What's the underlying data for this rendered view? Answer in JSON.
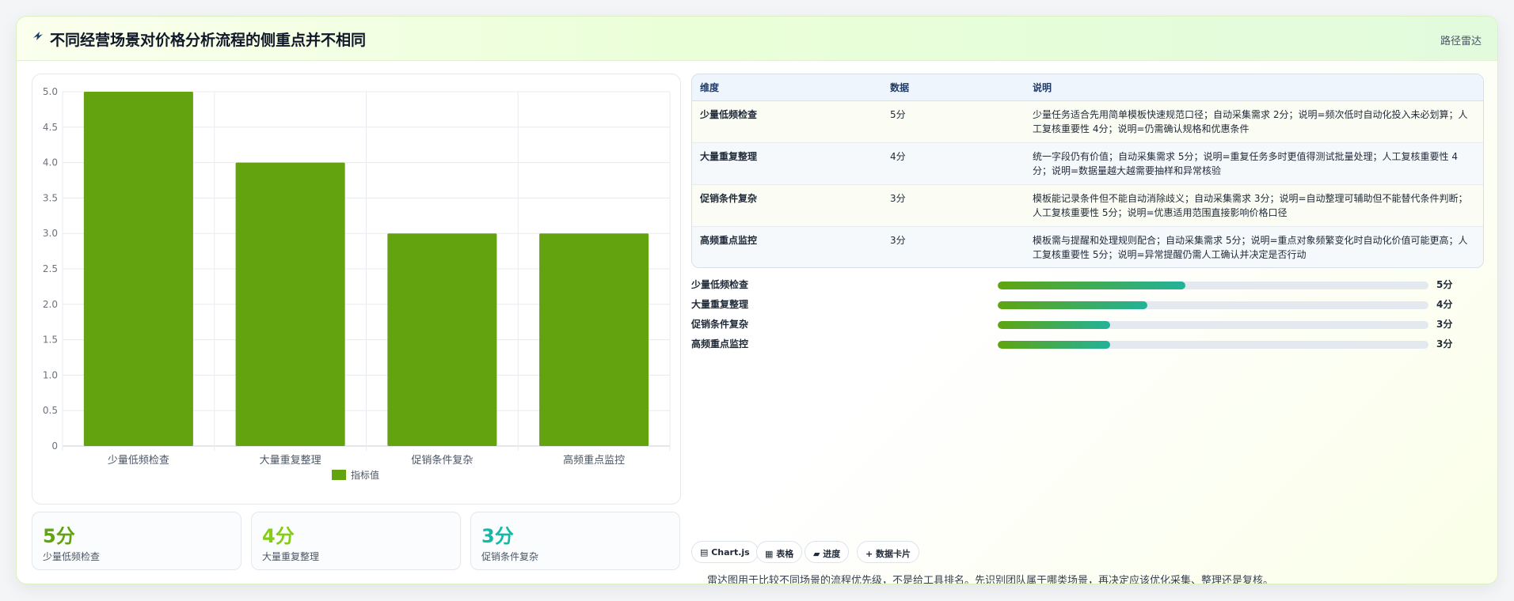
{
  "header": {
    "icon": "sparkle-icon",
    "title": "不同经营场景对价格分析流程的侧重点并不相同",
    "link": "路径雷达"
  },
  "colors": {
    "accent": "#62a30f",
    "teal": "#22b29a",
    "stat1": "#62a30f",
    "stat2": "#84cc16",
    "stat3": "#14b8a6"
  },
  "chart_data": {
    "type": "bar",
    "categories": [
      "少量低频检查",
      "大量重复整理",
      "促销条件复杂",
      "高频重点监控"
    ],
    "series": [
      {
        "name": "指标值",
        "values": [
          5,
          4,
          3,
          3
        ],
        "color": "#62a30f"
      }
    ],
    "yticks": [
      "0",
      "0.5",
      "1.0",
      "1.5",
      "2.0",
      "2.5",
      "3.0",
      "3.5",
      "4.0",
      "4.5",
      "5.0"
    ],
    "ylim": [
      0,
      5
    ],
    "grid": true,
    "legend": "bottom"
  },
  "stats": [
    {
      "value": "5分",
      "label": "少量低频检查"
    },
    {
      "value": "4分",
      "label": "大量重复整理"
    },
    {
      "value": "3分",
      "label": "促销条件复杂"
    }
  ],
  "table": {
    "headers": [
      "维度",
      "数据",
      "说明"
    ],
    "rows": [
      {
        "dim": "少量低频检查",
        "data": "5分",
        "desc": "少量任务适合先用简单模板快速规范口径；自动采集需求 2分；说明=频次低时自动化投入未必划算；人工复核重要性 4分；说明=仍需确认规格和优惠条件"
      },
      {
        "dim": "大量重复整理",
        "data": "4分",
        "desc": "统一字段仍有价值；自动采集需求 5分；说明=重复任务多时更值得测试批量处理；人工复核重要性 4分；说明=数据量越大越需要抽样和异常核验"
      },
      {
        "dim": "促销条件复杂",
        "data": "3分",
        "desc": "模板能记录条件但不能自动消除歧义；自动采集需求 3分；说明=自动整理可辅助但不能替代条件判断；人工复核重要性 5分；说明=优惠适用范围直接影响价格口径"
      },
      {
        "dim": "高频重点监控",
        "data": "3分",
        "desc": "模板需与提醒和处理规则配合；自动采集需求 5分；说明=重点对象频繁变化时自动化价值可能更高；人工复核重要性 5分；说明=异常提醒仍需人工确认并决定是否行动"
      }
    ]
  },
  "progress": [
    {
      "label": "少量低频检查",
      "value": "5分",
      "fraction": 0.435
    },
    {
      "label": "大量重复整理",
      "value": "4分",
      "fraction": 0.348
    },
    {
      "label": "促销条件复杂",
      "value": "3分",
      "fraction": 0.261
    },
    {
      "label": "高频重点监控",
      "value": "3分",
      "fraction": 0.261
    }
  ],
  "chips": [
    {
      "icon": "chart-icon",
      "label": "▤ Chart.js"
    },
    {
      "icon": "table-icon",
      "label": "▦ 表格"
    },
    {
      "icon": "progress-icon",
      "label": "▰ 进度"
    },
    {
      "icon": "card-icon",
      "label": "+ 数据卡片"
    }
  ],
  "note": "雷达图用于比较不同场景的流程优先级，不是给工具排名。先识别团队属于哪类场景，再决定应该优化采集、整理还是复核。"
}
